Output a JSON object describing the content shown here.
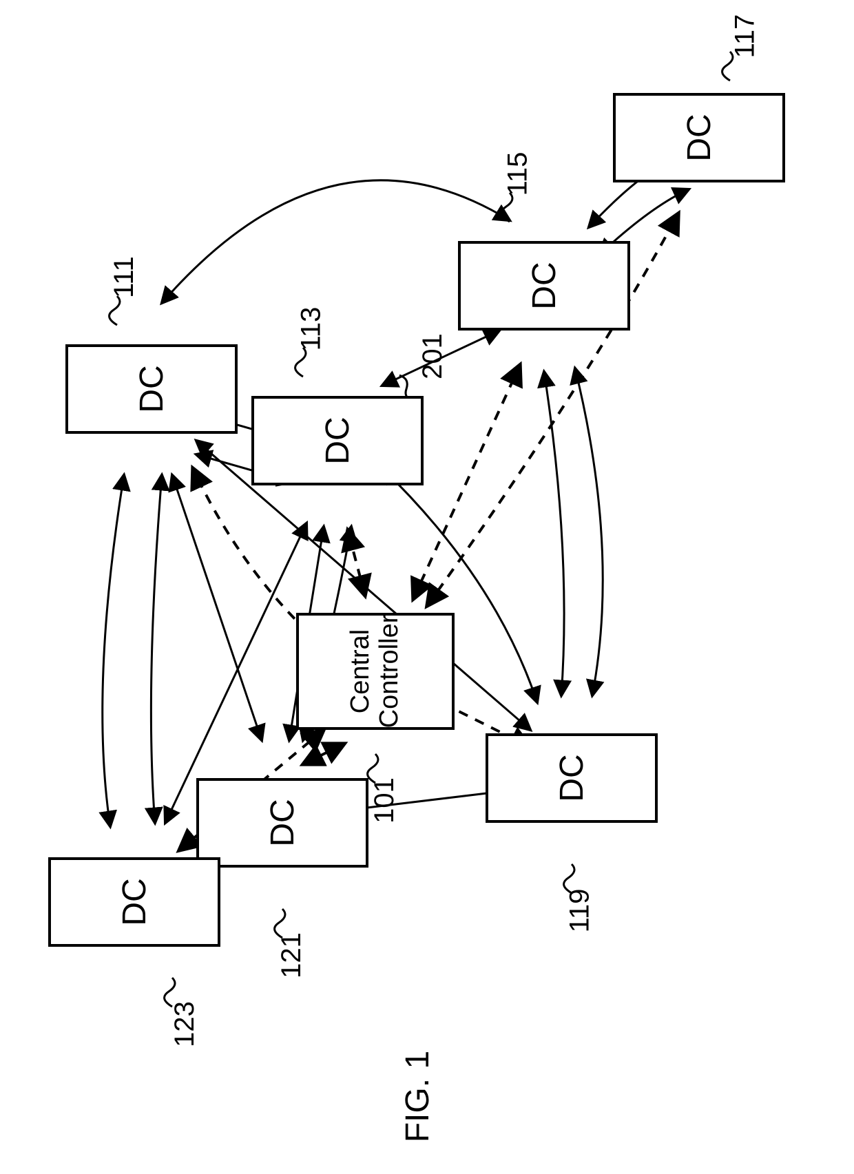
{
  "figure_caption": "FIG. 1",
  "nodes": {
    "n111": {
      "label": "DC",
      "ref": "111"
    },
    "n113": {
      "label": "DC",
      "ref": "113"
    },
    "n115": {
      "label": "DC",
      "ref": "115"
    },
    "n117": {
      "label": "DC",
      "ref": "117"
    },
    "n119": {
      "label": "DC",
      "ref": "119"
    },
    "n121": {
      "label": "DC",
      "ref": "121"
    },
    "n123": {
      "label": "DC",
      "ref": "123"
    },
    "n101": {
      "label": "Central\nController",
      "ref": "101"
    }
  },
  "extra_refs": {
    "r201": "201"
  },
  "links": {
    "solid_bidirectional": [
      [
        "n111",
        "n113"
      ],
      [
        "n113",
        "n115"
      ],
      [
        "n115",
        "n117"
      ],
      [
        "n111",
        "n115",
        "curve"
      ],
      [
        "n111",
        "n123"
      ],
      [
        "n123",
        "n121"
      ],
      [
        "n121",
        "n119"
      ],
      [
        "n113",
        "n111",
        "short"
      ],
      [
        "n113",
        "n119",
        "curve"
      ],
      [
        "n115",
        "n119"
      ],
      [
        "n113",
        "n123"
      ],
      [
        "n113",
        "n121"
      ],
      [
        "n111",
        "n121"
      ],
      [
        "n111",
        "n119",
        "long"
      ]
    ],
    "dashed_controller_to": [
      "n111",
      "n113",
      "n115",
      "n117",
      "n119",
      "n121",
      "n123"
    ]
  }
}
